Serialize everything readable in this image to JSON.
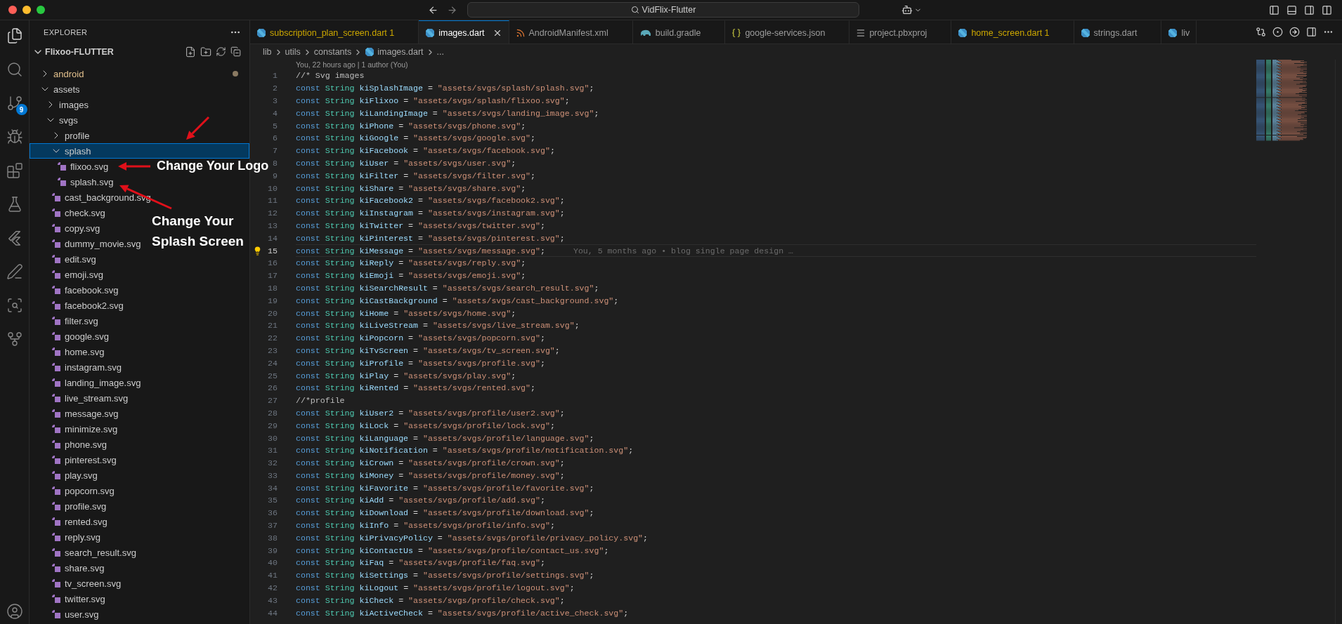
{
  "window": {
    "title": "VidFlix-Flutter"
  },
  "activity_bar": {
    "items": [
      {
        "selected": true
      },
      {
        "selected": false
      },
      {
        "selected": false,
        "badge": "9"
      },
      {
        "selected": false
      },
      {
        "selected": false
      },
      {
        "selected": false
      },
      {
        "selected": false
      },
      {
        "selected": false
      },
      {
        "selected": false
      },
      {
        "selected": false
      },
      {
        "selected": false
      }
    ]
  },
  "sidebar": {
    "title": "EXPLORER",
    "section": "Flixoo-FLUTTER",
    "tree": [
      {
        "label": "android",
        "kind": "folder",
        "expanded": false,
        "selected": false,
        "modified": true
      },
      {
        "label": "assets",
        "kind": "folder",
        "expanded": true,
        "selected": false,
        "modified": false,
        "children": [
          {
            "label": "images",
            "kind": "folder",
            "expanded": false,
            "selected": false,
            "modified": false
          },
          {
            "label": "svgs",
            "kind": "folder",
            "expanded": true,
            "selected": false,
            "modified": false,
            "children": [
              {
                "label": "profile",
                "kind": "folder",
                "expanded": false,
                "selected": false,
                "modified": false
              },
              {
                "label": "splash",
                "kind": "folder",
                "expanded": true,
                "selected": true,
                "modified": false,
                "children": [
                  {
                    "label": "flixoo.svg",
                    "kind": "file",
                    "selected": false,
                    "modified": false
                  },
                  {
                    "label": "splash.svg",
                    "kind": "file",
                    "selected": false,
                    "modified": false
                  }
                ]
              },
              {
                "label": "cast_background.svg",
                "kind": "file",
                "selected": false,
                "modified": false
              },
              {
                "label": "check.svg",
                "kind": "file",
                "selected": false,
                "modified": false
              },
              {
                "label": "copy.svg",
                "kind": "file",
                "selected": false,
                "modified": false
              },
              {
                "label": "dummy_movie.svg",
                "kind": "file",
                "selected": false,
                "modified": false
              },
              {
                "label": "edit.svg",
                "kind": "file",
                "selected": false,
                "modified": false
              },
              {
                "label": "emoji.svg",
                "kind": "file",
                "selected": false,
                "modified": false
              },
              {
                "label": "facebook.svg",
                "kind": "file",
                "selected": false,
                "modified": false
              },
              {
                "label": "facebook2.svg",
                "kind": "file",
                "selected": false,
                "modified": false
              },
              {
                "label": "filter.svg",
                "kind": "file",
                "selected": false,
                "modified": false
              },
              {
                "label": "google.svg",
                "kind": "file",
                "selected": false,
                "modified": false
              },
              {
                "label": "home.svg",
                "kind": "file",
                "selected": false,
                "modified": false
              },
              {
                "label": "instagram.svg",
                "kind": "file",
                "selected": false,
                "modified": false
              },
              {
                "label": "landing_image.svg",
                "kind": "file",
                "selected": false,
                "modified": false
              },
              {
                "label": "live_stream.svg",
                "kind": "file",
                "selected": false,
                "modified": false
              },
              {
                "label": "message.svg",
                "kind": "file",
                "selected": false,
                "modified": false
              },
              {
                "label": "minimize.svg",
                "kind": "file",
                "selected": false,
                "modified": false
              },
              {
                "label": "phone.svg",
                "kind": "file",
                "selected": false,
                "modified": false
              },
              {
                "label": "pinterest.svg",
                "kind": "file",
                "selected": false,
                "modified": false
              },
              {
                "label": "play.svg",
                "kind": "file",
                "selected": false,
                "modified": false
              },
              {
                "label": "popcorn.svg",
                "kind": "file",
                "selected": false,
                "modified": false
              },
              {
                "label": "profile.svg",
                "kind": "file",
                "selected": false,
                "modified": false
              },
              {
                "label": "rented.svg",
                "kind": "file",
                "selected": false,
                "modified": false
              },
              {
                "label": "reply.svg",
                "kind": "file",
                "selected": false,
                "modified": false
              },
              {
                "label": "search_result.svg",
                "kind": "file",
                "selected": false,
                "modified": false
              },
              {
                "label": "share.svg",
                "kind": "file",
                "selected": false,
                "modified": false
              },
              {
                "label": "tv_screen.svg",
                "kind": "file",
                "selected": false,
                "modified": false
              },
              {
                "label": "twitter.svg",
                "kind": "file",
                "selected": false,
                "modified": false
              },
              {
                "label": "user.svg",
                "kind": "file",
                "selected": false,
                "modified": false
              }
            ]
          }
        ]
      }
    ]
  },
  "tabs": [
    {
      "label": "subscription_plan_screen.dart",
      "badge": "1",
      "kind": "dart",
      "warning": true,
      "selected": false
    },
    {
      "label": "images.dart",
      "kind": "dart",
      "warning": false,
      "selected": true
    },
    {
      "label": "AndroidManifest.xml",
      "kind": "xml",
      "warning": false,
      "selected": false
    },
    {
      "label": "build.gradle",
      "kind": "gradle",
      "warning": false,
      "selected": false
    },
    {
      "label": "google-services.json",
      "kind": "json",
      "warning": false,
      "selected": false
    },
    {
      "label": "project.pbxproj",
      "kind": "text",
      "warning": false,
      "selected": false
    },
    {
      "label": "home_screen.dart",
      "badge": "1",
      "kind": "dart",
      "warning": true,
      "selected": false
    },
    {
      "label": "strings.dart",
      "kind": "dart",
      "warning": false,
      "selected": false
    },
    {
      "label": "liv",
      "kind": "dart",
      "warning": false,
      "selected": false
    }
  ],
  "breadcrumb": [
    {
      "label": "lib",
      "kind": "folder"
    },
    {
      "label": "utils",
      "kind": "folder"
    },
    {
      "label": "constants",
      "kind": "folder"
    },
    {
      "label": "images.dart",
      "kind": "dart"
    },
    {
      "label": "...",
      "kind": "more"
    }
  ],
  "codelens": "You, 22 hours ago | 1 author (You)",
  "lines": [
    {
      "number": "1",
      "kind": "comment",
      "text": "//* Svg images",
      "current": false
    },
    {
      "number": "2",
      "kind": "decl",
      "keyword": "const",
      "type": "String",
      "name": "kiSplashImage",
      "op": "=",
      "value": "\"assets/svgs/splash/splash.svg\"",
      "end": ";",
      "current": false
    },
    {
      "number": "3",
      "kind": "decl",
      "keyword": "const",
      "type": "String",
      "name": "kiFlixoo",
      "op": "=",
      "value": "\"assets/svgs/splash/flixoo.svg\"",
      "end": ";",
      "current": false
    },
    {
      "number": "4",
      "kind": "decl",
      "keyword": "const",
      "type": "String",
      "name": "kiLandingImage",
      "op": "=",
      "value": "\"assets/svgs/landing_image.svg\"",
      "end": ";",
      "current": false
    },
    {
      "number": "5",
      "kind": "decl",
      "keyword": "const",
      "type": "String",
      "name": "kiPhone",
      "op": "=",
      "value": "\"assets/svgs/phone.svg\"",
      "end": ";",
      "current": false
    },
    {
      "number": "6",
      "kind": "decl",
      "keyword": "const",
      "type": "String",
      "name": "kiGoogle",
      "op": "=",
      "value": "\"assets/svgs/google.svg\"",
      "end": ";",
      "current": false
    },
    {
      "number": "7",
      "kind": "decl",
      "keyword": "const",
      "type": "String",
      "name": "kiFacebook",
      "op": "=",
      "value": "\"assets/svgs/facebook.svg\"",
      "end": ";",
      "current": false
    },
    {
      "number": "8",
      "kind": "decl",
      "keyword": "const",
      "type": "String",
      "name": "kiUser",
      "op": "=",
      "value": "\"assets/svgs/user.svg\"",
      "end": ";",
      "current": false
    },
    {
      "number": "9",
      "kind": "decl",
      "keyword": "const",
      "type": "String",
      "name": "kiFilter",
      "op": "=",
      "value": "\"assets/svgs/filter.svg\"",
      "end": ";",
      "current": false
    },
    {
      "number": "10",
      "kind": "decl",
      "keyword": "const",
      "type": "String",
      "name": "kiShare",
      "op": "=",
      "value": "\"assets/svgs/share.svg\"",
      "end": ";",
      "current": false
    },
    {
      "number": "11",
      "kind": "decl",
      "keyword": "const",
      "type": "String",
      "name": "kiFacebook2",
      "op": "=",
      "value": "\"assets/svgs/facebook2.svg\"",
      "end": ";",
      "current": false
    },
    {
      "number": "12",
      "kind": "decl",
      "keyword": "const",
      "type": "String",
      "name": "kiInstagram",
      "op": "=",
      "value": "\"assets/svgs/instagram.svg\"",
      "end": ";",
      "current": false
    },
    {
      "number": "13",
      "kind": "decl",
      "keyword": "const",
      "type": "String",
      "name": "kiTwitter",
      "op": "=",
      "value": "\"assets/svgs/twitter.svg\"",
      "end": ";",
      "current": false
    },
    {
      "number": "14",
      "kind": "decl",
      "keyword": "const",
      "type": "String",
      "name": "kiPinterest",
      "op": "=",
      "value": "\"assets/svgs/pinterest.svg\"",
      "end": ";",
      "current": false
    },
    {
      "number": "15",
      "kind": "decl",
      "keyword": "const",
      "type": "String",
      "name": "kiMessage",
      "op": "=",
      "value": "\"assets/svgs/message.svg\"",
      "end": ";",
      "current": true,
      "blame": "You, 5 months ago • blog single page design …"
    },
    {
      "number": "16",
      "kind": "decl",
      "keyword": "const",
      "type": "String",
      "name": "kiReply",
      "op": "=",
      "value": "\"assets/svgs/reply.svg\"",
      "end": ";",
      "current": false
    },
    {
      "number": "17",
      "kind": "decl",
      "keyword": "const",
      "type": "String",
      "name": "kiEmoji",
      "op": "=",
      "value": "\"assets/svgs/emoji.svg\"",
      "end": ";",
      "current": false
    },
    {
      "number": "18",
      "kind": "decl",
      "keyword": "const",
      "type": "String",
      "name": "kiSearchResult",
      "op": "=",
      "value": "\"assets/svgs/search_result.svg\"",
      "end": ";",
      "current": false
    },
    {
      "number": "19",
      "kind": "decl",
      "keyword": "const",
      "type": "String",
      "name": "kiCastBackground",
      "op": "=",
      "value": "\"assets/svgs/cast_background.svg\"",
      "end": ";",
      "current": false
    },
    {
      "number": "20",
      "kind": "decl",
      "keyword": "const",
      "type": "String",
      "name": "kiHome",
      "op": "=",
      "value": "\"assets/svgs/home.svg\"",
      "end": ";",
      "current": false
    },
    {
      "number": "21",
      "kind": "decl",
      "keyword": "const",
      "type": "String",
      "name": "kiLiveStream",
      "op": "=",
      "value": "\"assets/svgs/live_stream.svg\"",
      "end": ";",
      "current": false
    },
    {
      "number": "22",
      "kind": "decl",
      "keyword": "const",
      "type": "String",
      "name": "kiPopcorn",
      "op": "=",
      "value": "\"assets/svgs/popcorn.svg\"",
      "end": ";",
      "current": false
    },
    {
      "number": "23",
      "kind": "decl",
      "keyword": "const",
      "type": "String",
      "name": "kiTvScreen",
      "op": "=",
      "value": "\"assets/svgs/tv_screen.svg\"",
      "end": ";",
      "current": false
    },
    {
      "number": "24",
      "kind": "decl",
      "keyword": "const",
      "type": "String",
      "name": "kiProfile",
      "op": "=",
      "value": "\"assets/svgs/profile.svg\"",
      "end": ";",
      "current": false
    },
    {
      "number": "25",
      "kind": "decl",
      "keyword": "const",
      "type": "String",
      "name": "kiPlay",
      "op": "=",
      "value": "\"assets/svgs/play.svg\"",
      "end": ";",
      "current": false
    },
    {
      "number": "26",
      "kind": "decl",
      "keyword": "const",
      "type": "String",
      "name": "kiRented",
      "op": "=",
      "value": "\"assets/svgs/rented.svg\"",
      "end": ";",
      "current": false
    },
    {
      "number": "27",
      "kind": "comment",
      "text": "//*profile",
      "current": false
    },
    {
      "number": "28",
      "kind": "decl",
      "keyword": "const",
      "type": "String",
      "name": "kiUser2",
      "op": "=",
      "value": "\"assets/svgs/profile/user2.svg\"",
      "end": ";",
      "current": false
    },
    {
      "number": "29",
      "kind": "decl",
      "keyword": "const",
      "type": "String",
      "name": "kiLock",
      "op": "=",
      "value": "\"assets/svgs/profile/lock.svg\"",
      "end": ";",
      "current": false
    },
    {
      "number": "30",
      "kind": "decl",
      "keyword": "const",
      "type": "String",
      "name": "kiLanguage",
      "op": "=",
      "value": "\"assets/svgs/profile/language.svg\"",
      "end": ";",
      "current": false
    },
    {
      "number": "31",
      "kind": "decl",
      "keyword": "const",
      "type": "String",
      "name": "kiNotification",
      "op": "=",
      "value": "\"assets/svgs/profile/notification.svg\"",
      "end": ";",
      "current": false
    },
    {
      "number": "32",
      "kind": "decl",
      "keyword": "const",
      "type": "String",
      "name": "kiCrown",
      "op": "=",
      "value": "\"assets/svgs/profile/crown.svg\"",
      "end": ";",
      "current": false
    },
    {
      "number": "33",
      "kind": "decl",
      "keyword": "const",
      "type": "String",
      "name": "kiMoney",
      "op": "=",
      "value": "\"assets/svgs/profile/money.svg\"",
      "end": ";",
      "current": false
    },
    {
      "number": "34",
      "kind": "decl",
      "keyword": "const",
      "type": "String",
      "name": "kiFavorite",
      "op": "=",
      "value": "\"assets/svgs/profile/favorite.svg\"",
      "end": ";",
      "current": false
    },
    {
      "number": "35",
      "kind": "decl",
      "keyword": "const",
      "type": "String",
      "name": "kiAdd",
      "op": "=",
      "value": "\"assets/svgs/profile/add.svg\"",
      "end": ";",
      "current": false
    },
    {
      "number": "36",
      "kind": "decl",
      "keyword": "const",
      "type": "String",
      "name": "kiDownload",
      "op": "=",
      "value": "\"assets/svgs/profile/download.svg\"",
      "end": ";",
      "current": false
    },
    {
      "number": "37",
      "kind": "decl",
      "keyword": "const",
      "type": "String",
      "name": "kiInfo",
      "op": "=",
      "value": "\"assets/svgs/profile/info.svg\"",
      "end": ";",
      "current": false
    },
    {
      "number": "38",
      "kind": "decl",
      "keyword": "const",
      "type": "String",
      "name": "kiPrivacyPolicy",
      "op": "=",
      "value": "\"assets/svgs/profile/privacy_policy.svg\"",
      "end": ";",
      "current": false
    },
    {
      "number": "39",
      "kind": "decl",
      "keyword": "const",
      "type": "String",
      "name": "kiContactUs",
      "op": "=",
      "value": "\"assets/svgs/profile/contact_us.svg\"",
      "end": ";",
      "current": false
    },
    {
      "number": "40",
      "kind": "decl",
      "keyword": "const",
      "type": "String",
      "name": "kiFaq",
      "op": "=",
      "value": "\"assets/svgs/profile/faq.svg\"",
      "end": ";",
      "current": false
    },
    {
      "number": "41",
      "kind": "decl",
      "keyword": "const",
      "type": "String",
      "name": "kiSettings",
      "op": "=",
      "value": "\"assets/svgs/profile/settings.svg\"",
      "end": ";",
      "current": false
    },
    {
      "number": "42",
      "kind": "decl",
      "keyword": "const",
      "type": "String",
      "name": "kiLogout",
      "op": "=",
      "value": "\"assets/svgs/profile/logout.svg\"",
      "end": ";",
      "current": false
    },
    {
      "number": "43",
      "kind": "decl",
      "keyword": "const",
      "type": "String",
      "name": "kiCheck",
      "op": "=",
      "value": "\"assets/svgs/profile/check.svg\"",
      "end": ";",
      "current": false
    },
    {
      "number": "44",
      "kind": "decl",
      "keyword": "const",
      "type": "String",
      "name": "kiActiveCheck",
      "op": "=",
      "value": "\"assets/svgs/profile/active_check.svg\"",
      "end": ";",
      "current": false
    }
  ],
  "annotations": [
    {
      "text": "Change Your Logo"
    },
    {
      "text": "Change Your Splash Screen"
    }
  ]
}
